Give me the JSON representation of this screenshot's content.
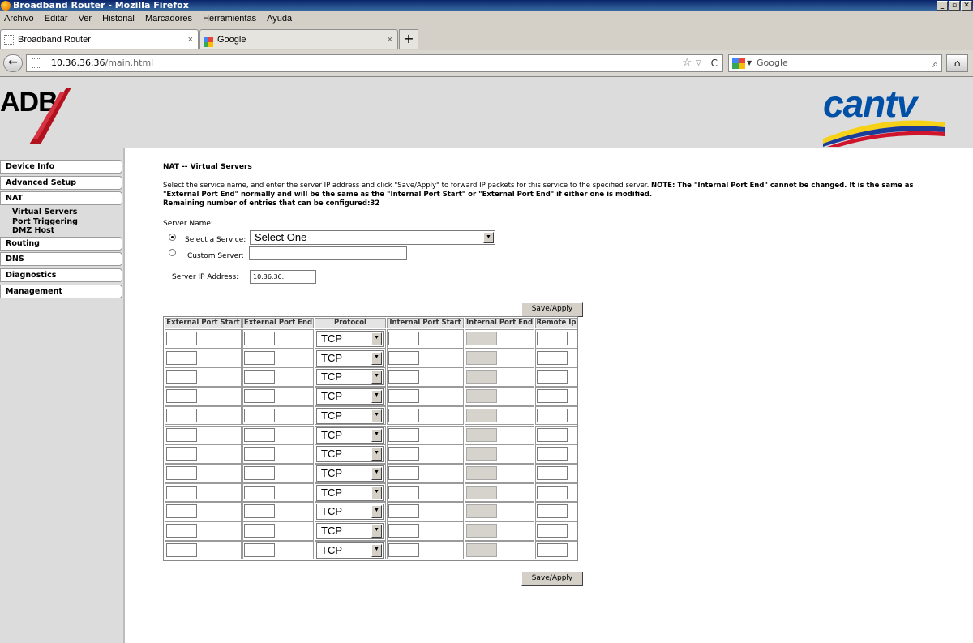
{
  "window": {
    "title": "Broadband Router - Mozilla Firefox",
    "buttons": [
      "_",
      "▫",
      "✕"
    ]
  },
  "menu": [
    "Archivo",
    "Editar",
    "Ver",
    "Historial",
    "Marcadores",
    "Herramientas",
    "Ayuda"
  ],
  "tabs": [
    {
      "label": "Broadband Router",
      "close": "×",
      "icon": "page-icon"
    },
    {
      "label": "Google",
      "close": "×",
      "icon": "google-icon"
    }
  ],
  "newtab": "+",
  "nav": {
    "back": "←",
    "url_host": "10.36.36.36",
    "url_path": "/main.html",
    "search_placeholder": "Google",
    "star": "☆",
    "dropdown": "▽",
    "reload": "C",
    "search_icon": "⌕",
    "home_icon": "⌂"
  },
  "header": {
    "left_logo": "ADB",
    "right_logo": "cantv"
  },
  "sidebar": {
    "items": [
      "Device Info",
      "Advanced Setup",
      "NAT",
      "Routing",
      "DNS",
      "Diagnostics",
      "Management"
    ],
    "nat_subitems": [
      "Virtual Servers",
      "Port Triggering",
      "DMZ Host"
    ]
  },
  "main": {
    "title": "NAT -- Virtual Servers",
    "intro": "Select the service name, and enter the server IP address and click \"Save/Apply\" to forward IP packets for this service to the specified server.",
    "note": "NOTE: The \"Internal Port End\" cannot be changed. It is the same as \"External Port End\" normally and will be the same as the \"Internal Port Start\" or \"External Port End\" if either one is modified.",
    "remaining": "Remaining number of entries that can be configured:32",
    "server_name_label": "Server Name:",
    "select_service_label": "Select a Service:",
    "select_service_value": "Select One",
    "custom_server_label": "Custom Server:",
    "custom_server_value": "",
    "server_ip_label": "Server IP Address:",
    "server_ip_value": "10.36.36.",
    "save_label": "Save/Apply"
  },
  "table": {
    "headers": [
      "External Port Start",
      "External Port End",
      "Protocol",
      "Internal Port Start",
      "Internal Port End",
      "Remote Ip"
    ],
    "row_count": 12,
    "protocol_value": "TCP"
  }
}
